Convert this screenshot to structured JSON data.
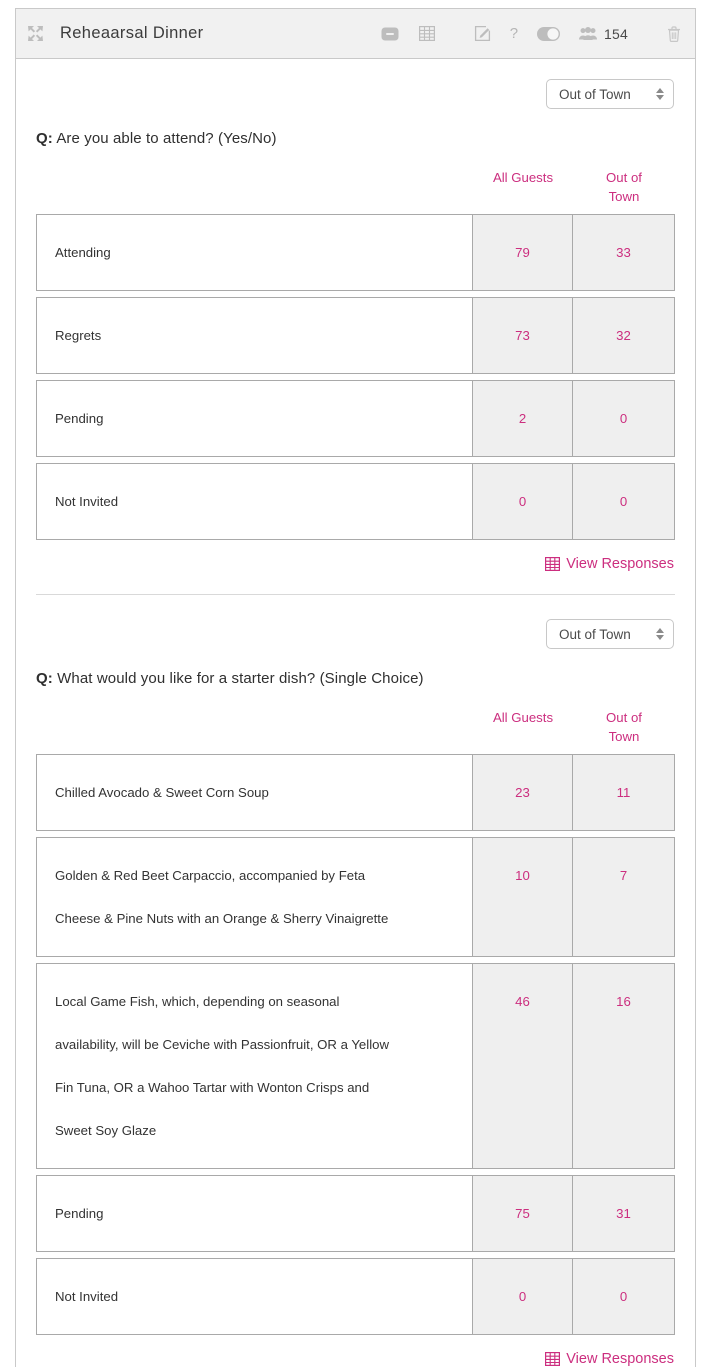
{
  "header": {
    "title": "Reheaarsal Dinner",
    "move_icon": "move-resize-icon",
    "collapse_icon": "minus-collapse-icon",
    "table_icon": "grid-table-icon",
    "edit_icon": "edit-pencil-icon",
    "help_label": "?",
    "toggle_icon": "toggle-switch-icon",
    "guests_icon": "group-people-icon",
    "guest_count": "154",
    "delete_icon": "trash-icon"
  },
  "accent_color": "#cc2e7f",
  "sections": [
    {
      "filter": {
        "value": "Out of Town",
        "options": [
          "All Guests",
          "Out of Town"
        ]
      },
      "question_label": "Q:",
      "question_text": " Are you able to attend? (Yes/No)",
      "columns": [
        "All Guests",
        "Out of Town"
      ],
      "column_lines": [
        [
          "All Guests"
        ],
        [
          "Out of",
          "Town"
        ]
      ],
      "rows": [
        {
          "label_lines": [
            "Attending"
          ],
          "all_guests": "79",
          "out_of_town": "33"
        },
        {
          "label_lines": [
            "Regrets"
          ],
          "all_guests": "73",
          "out_of_town": "32"
        },
        {
          "label_lines": [
            "Pending"
          ],
          "all_guests": "2",
          "out_of_town": "0"
        },
        {
          "label_lines": [
            "Not Invited"
          ],
          "all_guests": "0",
          "out_of_town": "0"
        }
      ],
      "view_responses": "View Responses"
    },
    {
      "filter": {
        "value": "Out of Town",
        "options": [
          "All Guests",
          "Out of Town"
        ]
      },
      "question_label": "Q:",
      "question_text": " What would you like for a starter dish? (Single Choice)",
      "columns": [
        "All Guests",
        "Out of Town"
      ],
      "column_lines": [
        [
          "All Guests"
        ],
        [
          "Out of",
          "Town"
        ]
      ],
      "rows": [
        {
          "label_lines": [
            "Chilled Avocado & Sweet Corn Soup"
          ],
          "all_guests": "23",
          "out_of_town": "11"
        },
        {
          "label_lines": [
            "Golden & Red Beet Carpaccio, accompanied by Feta",
            "Cheese & Pine Nuts with an Orange & Sherry Vinaigrette"
          ],
          "all_guests": "10",
          "out_of_town": "7"
        },
        {
          "label_lines": [
            "Local Game Fish, which, depending on seasonal",
            "availability, will be Ceviche with Passionfruit, OR a Yellow",
            "Fin Tuna, OR a Wahoo Tartar with Wonton Crisps and",
            "Sweet Soy Glaze"
          ],
          "all_guests": "46",
          "out_of_town": "16"
        },
        {
          "label_lines": [
            "Pending"
          ],
          "all_guests": "75",
          "out_of_town": "31"
        },
        {
          "label_lines": [
            "Not Invited"
          ],
          "all_guests": "0",
          "out_of_town": "0"
        }
      ],
      "view_responses": "View Responses"
    }
  ]
}
